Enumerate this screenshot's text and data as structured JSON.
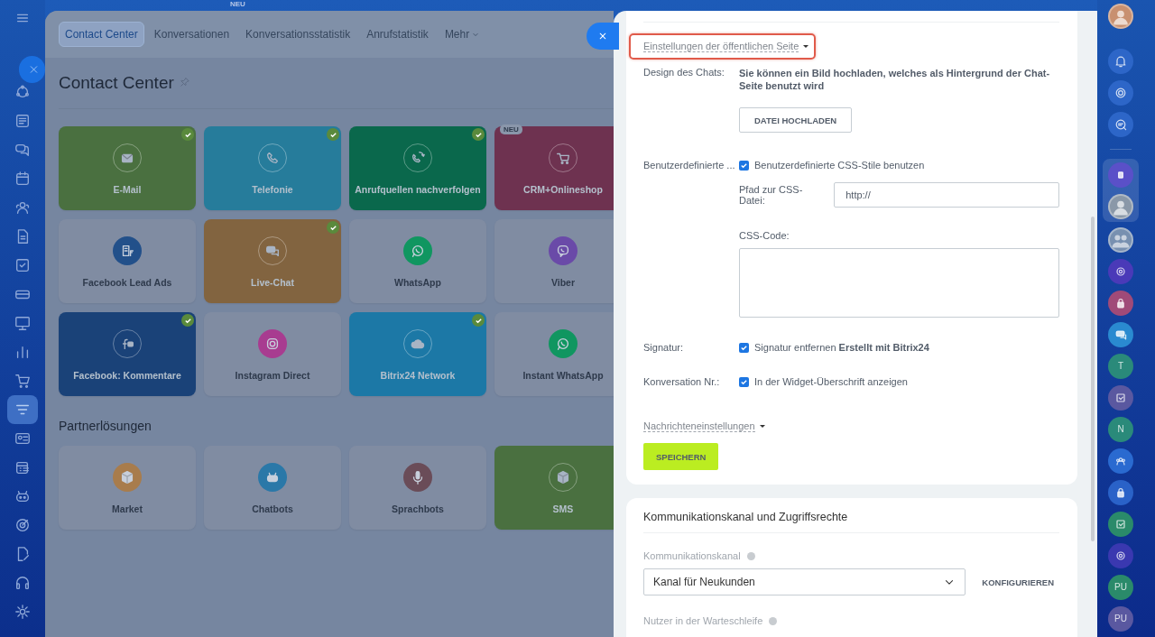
{
  "top_badge": "NEU",
  "left_sidebar": {
    "items": [
      {
        "selected": false
      },
      {
        "selected": false
      },
      {
        "selected": false
      },
      {
        "selected": false
      },
      {
        "selected": false
      },
      {
        "selected": false
      },
      {
        "selected": false
      },
      {
        "selected": false
      },
      {
        "selected": false
      },
      {
        "selected": false
      },
      {
        "selected": false
      },
      {
        "selected": true
      },
      {
        "selected": false
      },
      {
        "selected": false
      },
      {
        "selected": false
      },
      {
        "selected": false
      },
      {
        "selected": false
      },
      {
        "selected": false
      },
      {
        "selected": false
      }
    ]
  },
  "tabs": [
    {
      "label": "Contact Center",
      "selected": true,
      "kind": "plain"
    },
    {
      "label": "Konversationen",
      "selected": false,
      "kind": "plain"
    },
    {
      "label": "Konversationsstatistik",
      "selected": false,
      "kind": "plain"
    },
    {
      "label": "Anrufstatistik",
      "selected": false,
      "kind": "plain"
    },
    {
      "label": "Mehr",
      "selected": false,
      "kind": "dropdown"
    }
  ],
  "page_title": "Contact Center",
  "tiles": [
    {
      "label": "E-Mail",
      "active": true,
      "color": "#4a7040",
      "connected": true
    },
    {
      "label": "Telefonie",
      "active": true,
      "color": "#267c9b",
      "connected": true
    },
    {
      "label": "Anrufquellen nachverfolgen",
      "active": true,
      "color": "#0a684c",
      "connected": true
    },
    {
      "label": "CRM+Onlineshop",
      "active": true,
      "color": "#6e3250",
      "connected": false,
      "badge": "NEU"
    },
    {
      "label": "Facebook Lead Ads",
      "active": false,
      "color": "#22508a",
      "connected": false
    },
    {
      "label": "Live-Chat",
      "active": true,
      "color": "#826440",
      "connected": true
    },
    {
      "label": "WhatsApp",
      "active": false,
      "color": "#109660",
      "connected": false
    },
    {
      "label": "Viber",
      "active": false,
      "color": "#6a4aa8",
      "connected": false
    },
    {
      "label": "Facebook: Kommentare",
      "active": true,
      "color": "#1a4278",
      "connected": true
    },
    {
      "label": "Instagram Direct",
      "active": false,
      "color": "#a83c90",
      "connected": false
    },
    {
      "label": "Bitrix24 Network",
      "active": true,
      "color": "#1c78a6",
      "connected": true
    },
    {
      "label": "Instant WhatsApp",
      "active": false,
      "color": "#109660",
      "connected": false
    }
  ],
  "partner_section": {
    "title": "Partnerlösungen",
    "tiles": [
      {
        "label": "Market",
        "active": false,
        "color": "#a87c4c",
        "connected": false
      },
      {
        "label": "Chatbots",
        "active": false,
        "color": "#2a78a8",
        "connected": false
      },
      {
        "label": "Sprachbots",
        "active": false,
        "color": "#6a4c58",
        "connected": false
      },
      {
        "label": "SMS",
        "active": true,
        "color": "#4a7040",
        "connected": false
      }
    ]
  },
  "settings_card": {
    "section_toggle": {
      "label": "Einstellungen der öffentlichen Seite",
      "highlighted": true
    },
    "rows": [
      {
        "kind": "upload",
        "label": "Design des Chats:",
        "text": "Sie können ein Bild hochladen, welches als Hintergrund der Chat-Seite benutzt wird",
        "button": "DATEI HOCHLADEN"
      },
      {
        "kind": "css",
        "label": "Benutzerdefinierte ...",
        "checkbox": {
          "label": "Benutzerdefinierte CSS-Stile benutzen",
          "checked": true
        },
        "path_label": "Pfad zur CSS-Datei:",
        "path_value": "http://",
        "code_label": "CSS-Code:"
      },
      {
        "kind": "checkbox",
        "label": "Signatur:",
        "checkbox": {
          "label": "Signatur entfernen **Erstellt mit Bitrix24**",
          "checked": true
        }
      },
      {
        "kind": "checkbox",
        "label": "Konversation Nr.:",
        "checkbox": {
          "label": "In der Widget-Überschrift anzeigen",
          "checked": true
        }
      }
    ],
    "message_toggle": {
      "label": "Nachrichteneinstellungen"
    },
    "save_button": "SPEICHERN"
  },
  "access_card": {
    "title": "Kommunikationskanal und Zugriffsrechte",
    "channel_label": "Kommunikationskanal",
    "channel_value": "Kanal für Neukunden",
    "configure_button": "KONFIGURIEREN",
    "queue_label": "Nutzer in der Warteschleife"
  },
  "right_sidebar": {
    "top": [
      {
        "kind": "avatar",
        "color": "#c89070"
      },
      {
        "kind": "icon",
        "color": "#2d66c8"
      },
      {
        "kind": "icon",
        "color": "#2d66c8"
      },
      {
        "kind": "icon",
        "color": "#2d66c8"
      }
    ],
    "pinned": [
      {
        "kind": "icon",
        "color": "#5a50c8"
      },
      {
        "kind": "avatar",
        "color": "#8a98a8"
      }
    ],
    "recent": [
      {
        "kind": "group",
        "color": "#7890b0"
      },
      {
        "kind": "icon",
        "color": "#4a3ab8"
      },
      {
        "kind": "icon",
        "color": "#a04a78"
      },
      {
        "kind": "icon",
        "color": "#2a8ad0"
      },
      {
        "kind": "initials",
        "text": "T",
        "color": "#2a8a7a"
      },
      {
        "kind": "icon",
        "color": "#5a58a0"
      },
      {
        "kind": "initials",
        "text": "N",
        "color": "#2a8a7a"
      },
      {
        "kind": "icon",
        "color": "#2a6ad0"
      },
      {
        "kind": "icon",
        "color": "#2a62c8"
      },
      {
        "kind": "icon",
        "color": "#2a8a6a"
      },
      {
        "kind": "icon",
        "color": "#3a38b0"
      },
      {
        "kind": "initials",
        "text": "PU",
        "color": "#2a8a6a"
      },
      {
        "kind": "initials",
        "text": "PU",
        "color": "#5a58a0"
      }
    ]
  }
}
